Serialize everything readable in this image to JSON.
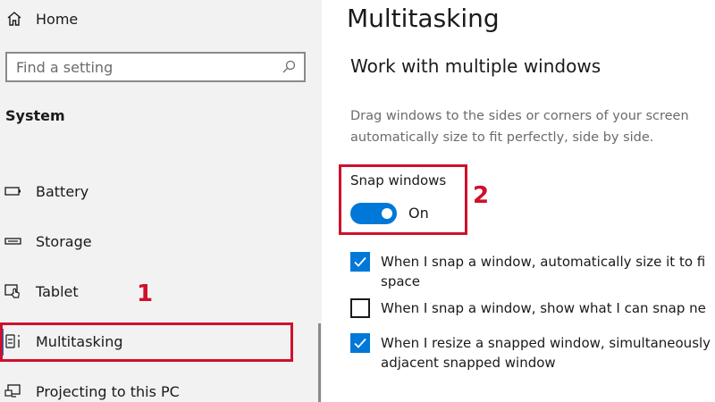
{
  "sidebar": {
    "home_label": "Home",
    "search_placeholder": "Find a setting",
    "section_title": "System",
    "items": [
      {
        "label": "Battery",
        "icon": "battery-icon"
      },
      {
        "label": "Storage",
        "icon": "storage-icon"
      },
      {
        "label": "Tablet",
        "icon": "tablet-icon"
      },
      {
        "label": "Multitasking",
        "icon": "multitasking-icon",
        "selected": true
      },
      {
        "label": "Projecting to this PC",
        "icon": "projecting-icon"
      }
    ]
  },
  "annotations": {
    "first": "1",
    "second": "2"
  },
  "main": {
    "title": "Multitasking",
    "section_heading": "Work with multiple windows",
    "description_line1": "Drag windows to the sides or corners of your screen",
    "description_line2": "automatically size to fit perfectly, side by side.",
    "snap": {
      "label": "Snap windows",
      "state": "On",
      "on": true
    },
    "options": [
      {
        "line1": "When I snap a window, automatically size it to fi",
        "line2": "space",
        "checked": true
      },
      {
        "line1": "When I snap a window, show what I can snap ne",
        "line2": "",
        "checked": false
      },
      {
        "line1": "When I resize a snapped window, simultaneously",
        "line2": "adjacent snapped window",
        "checked": true
      }
    ]
  },
  "colors": {
    "accent": "#0078d7",
    "annotation": "#d0102b",
    "sidebar_bg": "#f2f2f2"
  }
}
